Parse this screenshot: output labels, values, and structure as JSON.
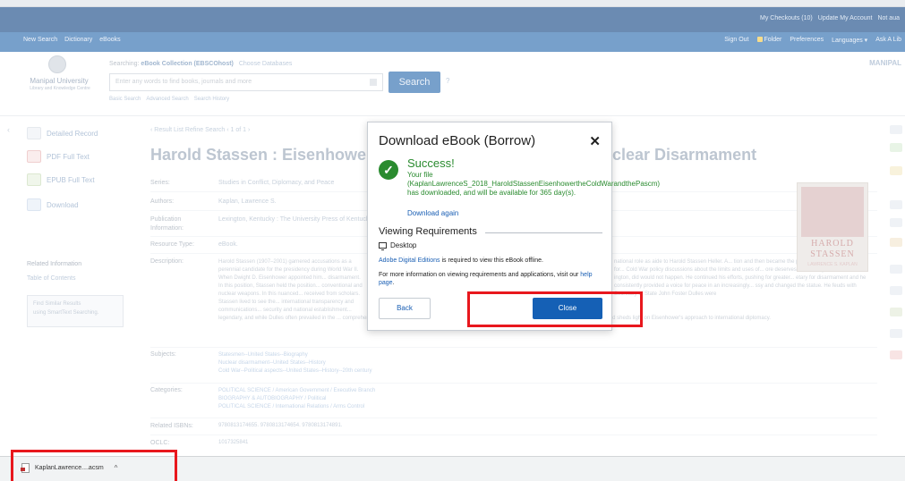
{
  "topbar": {
    "links": [
      "My Checkouts (10)",
      "Update My Account",
      "Not aua"
    ]
  },
  "navbar": {
    "left": [
      "New Search",
      "Dictionary",
      "eBooks"
    ],
    "right": [
      "Sign Out",
      "Folder",
      "Preferences",
      "Languages ▾",
      "Ask A Lib"
    ]
  },
  "branding": {
    "org_name": "Manipal University",
    "org_sub": "Library and Knowledge Centre",
    "right_label": "MANIPAL"
  },
  "search": {
    "searching_label": "Searching:",
    "database": "eBook Collection (EBSCOhost)",
    "choose_db": "Choose Databases",
    "placeholder": "Enter any words to find books, journals and more",
    "button": "Search",
    "help": "?",
    "links": [
      "Basic Search",
      "Advanced Search",
      "Search History"
    ]
  },
  "sidebar": {
    "items": [
      {
        "label": "Detailed Record"
      },
      {
        "label": "PDF Full Text"
      },
      {
        "label": "EPUB Full Text"
      },
      {
        "label": "Download"
      }
    ],
    "related_title": "Related Information",
    "toc": "Table of Contents",
    "similar_title": "Find Similar Results",
    "similar_sub": "using SmartText Searching."
  },
  "record": {
    "breadcrumb": "‹ Result List   Refine Search   ‹ 1 of 1 ›",
    "title_left": "Harold Stassen : Eisenhower, t",
    "title_right": "clear Disarmament",
    "fields": [
      {
        "label": "Series:",
        "value": "Studies in Conflict, Diplomacy, and Peace"
      },
      {
        "label": "Authors:",
        "value": "Kaplan, Lawrence S."
      },
      {
        "label": "Publication",
        "value": "Lexington, Kentucky : The University Press of Kentucky"
      },
      {
        "label": "Information:",
        "value": ""
      },
      {
        "label": "Resource Type:",
        "value": "eBook."
      },
      {
        "label": "Description:",
        "value": ""
      }
    ],
    "description_left": "Harold Stassen (1907–2001) garnered accusations as a perennial candidate for the presidency during World War II. When Dwight D. Eisenhower appointed him... disarmament. In this position, Stassen held the position... conventional and nuclear weapons. In this nuanced... received from scholars. Stassen lived to see the... international transparency and communications... security and national establishment...",
    "description_right": "national role as aide to Harold Stassen Heller. A... tion and then became the president's special assistant for... Cold War policy discussions about the limits and uses of... ore deserves more analysis than it has... ington, did would not happen. He continued his efforts, pushing for greater... etary for disarmament and he consistently provided a voice for peace in an increasingly... ssy and changed the statue. He feuds with Secretary of State John Foster Dulles were",
    "description_bottom": "legendary, and while Dulles often prevailed in the ... comprehensive study provides a new perspective on nuclear disarmament during a critical period in US history and sheds light on Eisenhower's approach to international diplomacy.",
    "subjects_label": "Subjects:",
    "subjects": [
      "Statesmen--United States--Biography",
      "Nuclear disarmament--United States--History",
      "Cold War--Political aspects--United States--History--20th century"
    ],
    "categories_label": "Categories:",
    "categories": [
      "POLITICAL SCIENCE / American Government / Executive Branch",
      "BIOGRAPHY & AUTOBIOGRAPHY / Political",
      "POLITICAL SCIENCE / International Relations / Arms Control"
    ],
    "isbn_label": "Related ISBNs:",
    "isbn": "9780813174655. 9780813174654. 9780813174891.",
    "oclc_label": "OCLC:",
    "oclc": "1017325841"
  },
  "cover": {
    "line1": "HAROLD",
    "line2": "STASSEN",
    "line3": "LAWRENCE S. KAPLAN"
  },
  "modal": {
    "title": "Download eBook (Borrow)",
    "close_x": "✕",
    "success_title": "Success!",
    "success_msg": "Your file (KaplanLawrenceS_2018_HaroldStassenEisenhowertheColdWarandthePascm) has downloaded, and will be available for 365 day(s).",
    "download_again": "Download again",
    "viewing_title": "Viewing Requirements",
    "platform": "Desktop",
    "ade_link": "Adobe Digital Editions",
    "ade_rest": " is required to view this eBook offline.",
    "more_info": "For more information on viewing requirements and applications, visit our ",
    "help_page": "help page",
    "more_info_end": ".",
    "back": "Back",
    "close": "Close"
  },
  "shelf": {
    "filename": "KaplanLawrence....acsm",
    "chevron": "^"
  },
  "colors": {
    "primary_blue": "#1560b5",
    "success_green": "#2a8b2f",
    "highlight_red": "#e8171d"
  }
}
